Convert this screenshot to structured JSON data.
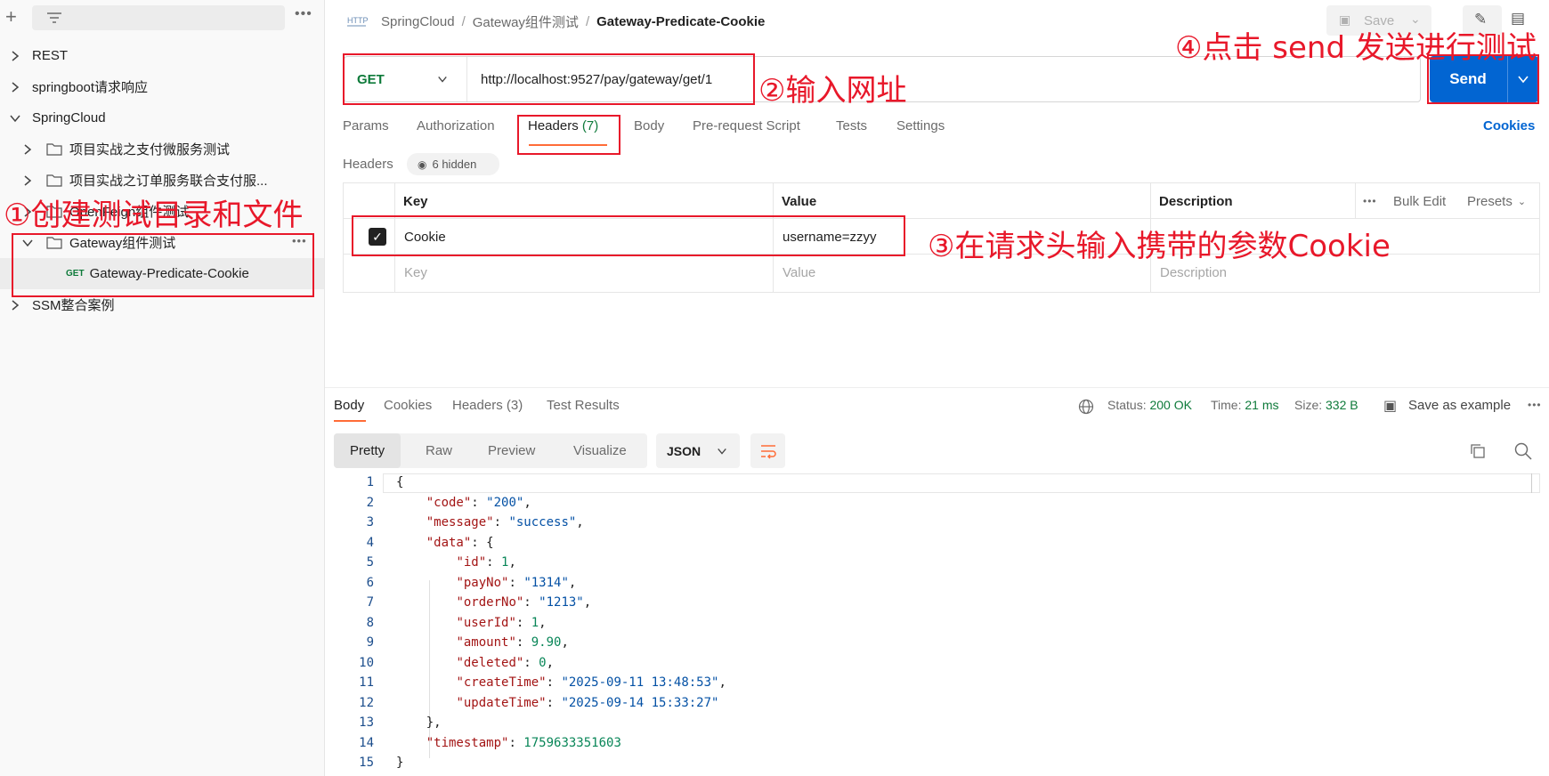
{
  "sidebar": {
    "items": [
      {
        "label": "REST"
      },
      {
        "label": "springboot请求响应"
      },
      {
        "label": "SpringCloud"
      },
      {
        "label": "项目实战之支付微服务测试"
      },
      {
        "label": "项目实战之订单服务联合支付服..."
      },
      {
        "label": "OpenFeign组件测试"
      },
      {
        "label": "Gateway组件测试"
      },
      {
        "label": "Gateway-Predicate-Cookie",
        "method": "GET"
      },
      {
        "label": "SSM整合案例"
      }
    ]
  },
  "header": {
    "crumb1": "SpringCloud",
    "crumb2": "Gateway组件测试",
    "current": "Gateway-Predicate-Cookie",
    "save_label": "Save"
  },
  "request": {
    "method": "GET",
    "url": "http://localhost:9527/pay/gateway/get/1",
    "send_label": "Send"
  },
  "tabs": {
    "params": "Params",
    "authorization": "Authorization",
    "headers": "Headers",
    "headers_count": "(7)",
    "body": "Body",
    "prerequest": "Pre-request Script",
    "tests": "Tests",
    "settings": "Settings",
    "cookies": "Cookies"
  },
  "headers_section": {
    "title": "Headers",
    "hidden": "6 hidden",
    "col_key": "Key",
    "col_value": "Value",
    "col_description": "Description",
    "bulk_edit": "Bulk Edit",
    "presets": "Presets",
    "row_key": "Cookie",
    "row_value": "username=zzyy",
    "ph_key": "Key",
    "ph_value": "Value",
    "ph_description": "Description"
  },
  "response": {
    "tabs": {
      "body": "Body",
      "cookies": "Cookies",
      "headers": "Headers",
      "headers_count": "(3)",
      "test_results": "Test Results"
    },
    "status_label": "Status:",
    "status_value": "200 OK",
    "time_label": "Time:",
    "time_value": "21 ms",
    "size_label": "Size:",
    "size_value": "332 B",
    "save_example": "Save as example",
    "view": {
      "pretty": "Pretty",
      "raw": "Raw",
      "preview": "Preview",
      "visualize": "Visualize"
    },
    "format": "JSON",
    "line_numbers": [
      "1",
      "2",
      "3",
      "4",
      "5",
      "6",
      "7",
      "8",
      "9",
      "10",
      "11",
      "12",
      "13",
      "14",
      "15"
    ],
    "code": {
      "code_key": "\"code\"",
      "code_val": "\"200\"",
      "message_key": "\"message\"",
      "message_val": "\"success\"",
      "data_key": "\"data\"",
      "id_key": "\"id\"",
      "id_val": "1",
      "payNo_key": "\"payNo\"",
      "payNo_val": "\"1314\"",
      "orderNo_key": "\"orderNo\"",
      "orderNo_val": "\"1213\"",
      "userId_key": "\"userId\"",
      "userId_val": "1",
      "amount_key": "\"amount\"",
      "amount_val": "9.90",
      "deleted_key": "\"deleted\"",
      "deleted_val": "0",
      "createTime_key": "\"createTime\"",
      "createTime_val": "\"2025-09-11 13:48:53\"",
      "updateTime_key": "\"updateTime\"",
      "updateTime_val": "\"2025-09-14 15:33:27\"",
      "timestamp_key": "\"timestamp\"",
      "timestamp_val": "1759633351603"
    }
  },
  "annotations": {
    "a1": "①创建测试目录和文件",
    "a2": "②输入网址",
    "a3": "③在请求头输入携带的参数Cookie",
    "a4": "④点击 send 发送进行测试"
  },
  "colors": {
    "accent": "#0265d2",
    "annotation": "#e8182a",
    "get": "#0e7a3a"
  }
}
